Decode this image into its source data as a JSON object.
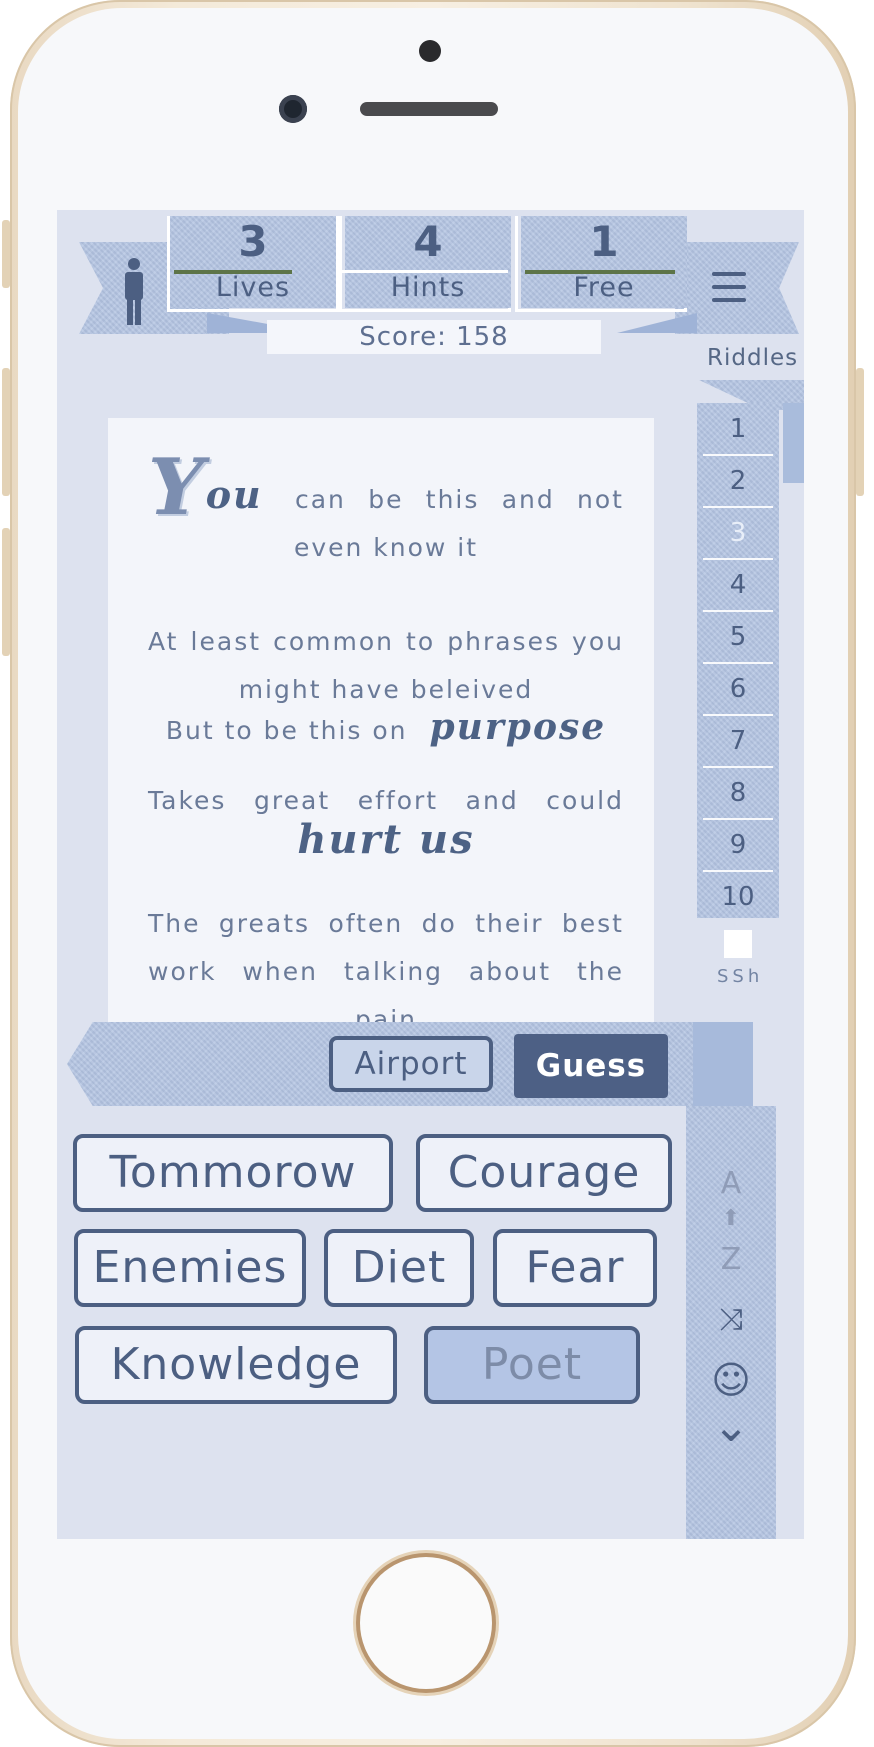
{
  "stats": {
    "lives": {
      "value": "3",
      "label": "Lives"
    },
    "hints": {
      "value": "4",
      "label": "Hints"
    },
    "free": {
      "value": "1",
      "label": "Free"
    }
  },
  "score": "Score: 158",
  "riddles_label": "Riddles",
  "riddle_tabs": [
    "1",
    "2",
    "3",
    "4",
    "5",
    "6",
    "7",
    "8",
    "9",
    "10"
  ],
  "riddle_tabs_more": "SSho",
  "riddle": {
    "dropcap": "Y",
    "first_word_rest": "ou",
    "line1": "can be this and not even know it",
    "line2": "At least common to phrases you might have beleived",
    "line3_prefix": "But to be this on",
    "line3_emph": "purpose",
    "line4": "Takes great effort and could",
    "line4_emph": "hurt us",
    "line5": "The greats often do their best work when talking about the pain"
  },
  "answer": {
    "value": "Airport",
    "guess_label": "Guess"
  },
  "tools": {
    "sort_a": "A",
    "sort_z": "Z",
    "arrow": "⬆",
    "shuffle": "⤨",
    "smile": "☺",
    "collapse": "⌄"
  },
  "words": [
    {
      "label": "Tommorow",
      "selected": false
    },
    {
      "label": "Courage",
      "selected": false
    },
    {
      "label": "Enemies",
      "selected": false
    },
    {
      "label": "Diet",
      "selected": false
    },
    {
      "label": "Fear",
      "selected": false
    },
    {
      "label": "Knowledge",
      "selected": false
    },
    {
      "label": "Poet",
      "selected": true
    }
  ],
  "colors": {
    "accent": "#4d6085",
    "denim": "#b3c4e2",
    "background": "#dde2ef",
    "bar_green": "#5d7448"
  }
}
